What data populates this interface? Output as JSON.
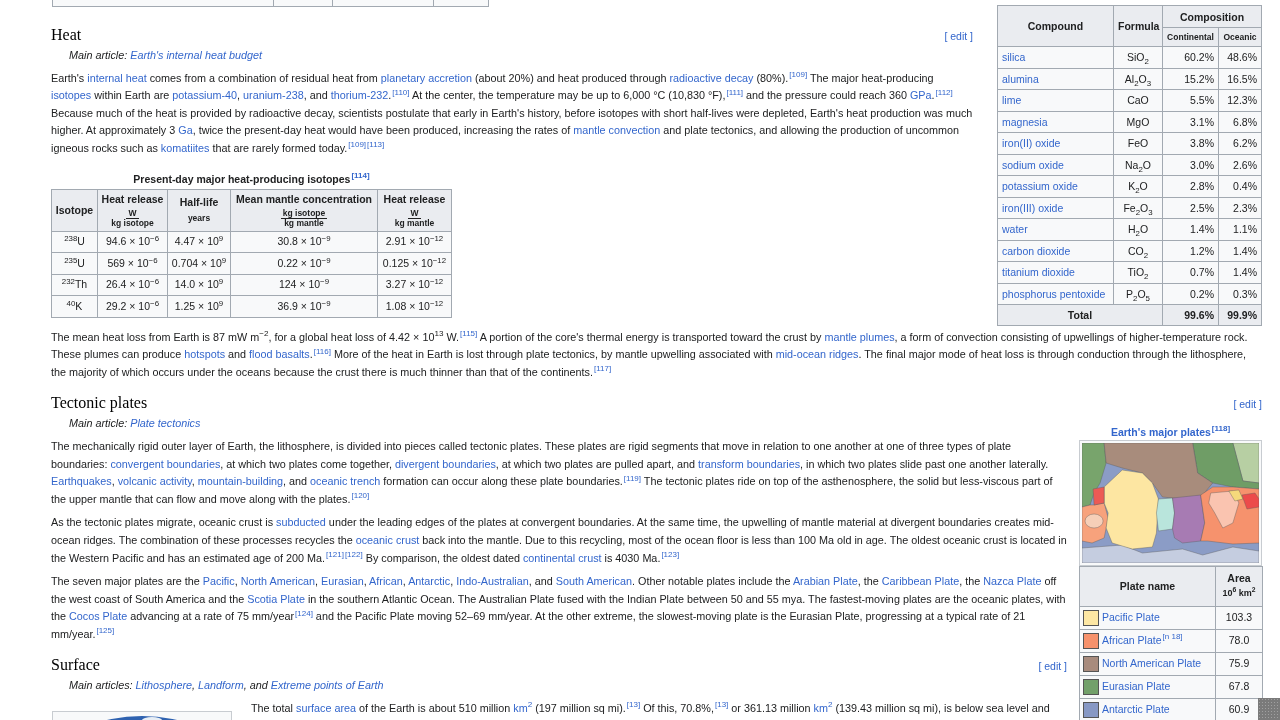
{
  "crust_composition": {
    "columns": [
      {
        "label": "Compound"
      },
      {
        "label": "Formula"
      },
      {
        "label": "Composition",
        "children": [
          {
            "label": "Continental"
          },
          {
            "label": "Oceanic"
          }
        ]
      }
    ],
    "rows": [
      {
        "compound": "silica",
        "formula": "SiO$_{2}$",
        "continental": "60.2%",
        "oceanic": "48.6%"
      },
      {
        "compound": "alumina",
        "formula": "Al$_{2}$O$_{3}$",
        "continental": "15.2%",
        "oceanic": "16.5%"
      },
      {
        "compound": "lime",
        "formula": "CaO",
        "continental": "5.5%",
        "oceanic": "12.3%"
      },
      {
        "compound": "magnesia",
        "formula": "MgO",
        "continental": "3.1%",
        "oceanic": "6.8%"
      },
      {
        "compound": "iron(II) oxide",
        "formula": "FeO",
        "continental": "3.8%",
        "oceanic": "6.2%"
      },
      {
        "compound": "sodium oxide",
        "formula": "Na$_{2}$O",
        "continental": "3.0%",
        "oceanic": "2.6%"
      },
      {
        "compound": "potassium oxide",
        "formula": "K$_{2}$O",
        "continental": "2.8%",
        "oceanic": "0.4%"
      },
      {
        "compound": "iron(III) oxide",
        "formula": "Fe$_{2}$O$_{3}$",
        "continental": "2.5%",
        "oceanic": "2.3%"
      },
      {
        "compound": "water",
        "formula": "H$_{2}$O",
        "continental": "1.4%",
        "oceanic": "1.1%"
      },
      {
        "compound": "carbon dioxide",
        "formula": "CO$_{2}$",
        "continental": "1.2%",
        "oceanic": "1.4%"
      },
      {
        "compound": "titanium dioxide",
        "formula": "TiO$_{2}$",
        "continental": "0.7%",
        "oceanic": "1.4%"
      },
      {
        "compound": "phosphorus pentoxide",
        "formula": "P$_{2}$O$_{5}$",
        "continental": "0.2%",
        "oceanic": "0.3%"
      }
    ],
    "total": {
      "label": "Total",
      "continental": "99.6%",
      "oceanic": "99.9%"
    }
  },
  "sections": [
    {
      "heading": "Heat",
      "edit": "[ edit ]",
      "hatnote": [
        {
          "kind": "text",
          "text": "Main article: "
        },
        {
          "kind": "link",
          "text": "Earth's internal heat budget"
        }
      ],
      "blocks": [
        {
          "kind": "paragraph",
          "runs": [
            {
              "kind": "text",
              "text": "Earth's "
            },
            {
              "kind": "link",
              "text": "internal heat"
            },
            {
              "kind": "text",
              "text": " comes from a combination of residual heat from "
            },
            {
              "kind": "link",
              "text": "planetary accretion"
            },
            {
              "kind": "text",
              "text": " (about 20%) and heat produced through "
            },
            {
              "kind": "link",
              "text": "radioactive decay"
            },
            {
              "kind": "text",
              "text": " (80%)."
            },
            {
              "kind": "ref",
              "text": "[109]"
            },
            {
              "kind": "text",
              "text": " The major heat-producing "
            },
            {
              "kind": "link",
              "text": "isotopes"
            },
            {
              "kind": "text",
              "text": " within Earth are "
            },
            {
              "kind": "link",
              "text": "potassium-40"
            },
            {
              "kind": "text",
              "text": ", "
            },
            {
              "kind": "link",
              "text": "uranium-238"
            },
            {
              "kind": "text",
              "text": ", and "
            },
            {
              "kind": "link",
              "text": "thorium-232"
            },
            {
              "kind": "text",
              "text": "."
            },
            {
              "kind": "ref",
              "text": "[110]"
            },
            {
              "kind": "text",
              "text": " At the center, the temperature may be up to 6,000 °C (10,830 °F),"
            },
            {
              "kind": "ref",
              "text": "[111]"
            },
            {
              "kind": "text",
              "text": " and the pressure could reach 360 "
            },
            {
              "kind": "link",
              "text": "GPa"
            },
            {
              "kind": "text",
              "text": "."
            },
            {
              "kind": "ref",
              "text": "[112]"
            },
            {
              "kind": "text",
              "text": " Because much of the heat is provided by radioactive decay, scientists postulate that early in Earth's history, before isotopes with short half-lives were depleted, Earth's heat production was much higher. At approximately 3 "
            },
            {
              "kind": "link",
              "text": "Ga"
            },
            {
              "kind": "text",
              "text": ", twice the present-day heat would have been produced, increasing the rates of "
            },
            {
              "kind": "link",
              "text": "mantle convection"
            },
            {
              "kind": "text",
              "text": " and plate tectonics, and allowing the production of uncommon igneous rocks such as "
            },
            {
              "kind": "link",
              "text": "komatiites"
            },
            {
              "kind": "text",
              "text": " that are rarely formed today."
            },
            {
              "kind": "ref",
              "text": "[109]"
            },
            {
              "kind": "ref",
              "text": "[113]"
            }
          ]
        },
        {
          "kind": "isotope_table",
          "caption": [
            {
              "kind": "text",
              "text": "Present-day major heat-producing isotopes"
            },
            {
              "kind": "ref",
              "text": "[114]"
            }
          ],
          "columns": [
            {
              "label": "Isotope"
            },
            {
              "label": "Heat release",
              "unit": {
                "kind": "fraction",
                "numerator": "W",
                "denominator": "kg isotope"
              }
            },
            {
              "label": "Half-life",
              "unit": {
                "kind": "plain",
                "text": "years"
              }
            },
            {
              "label": "Mean mantle concentration",
              "unit": {
                "kind": "fraction",
                "numerator": "kg isotope",
                "denominator": "kg mantle"
              }
            },
            {
              "label": "Heat release",
              "unit": {
                "kind": "fraction",
                "numerator": "W",
                "denominator": "kg mantle"
              }
            }
          ],
          "rows": [
            [
              "$^{238}$U",
              "94.6 × 10$^{−6}$",
              "4.47 × 10$^{9}$",
              "30.8 × 10$^{−9}$",
              "2.91 × 10$^{−12}$"
            ],
            [
              "$^{235}$U",
              "569 × 10$^{−6}$",
              "0.704 × 10$^{9}$",
              "0.22 × 10$^{−9}$",
              "0.125 × 10$^{−12}$"
            ],
            [
              "$^{232}$Th",
              "26.4 × 10$^{−6}$",
              "14.0 × 10$^{9}$",
              "124 × 10$^{−9}$",
              "3.27 × 10$^{−12}$"
            ],
            [
              "$^{40}$K",
              "29.2 × 10$^{−6}$",
              "1.25 × 10$^{9}$",
              "36.9 × 10$^{−9}$",
              "1.08 × 10$^{−12}$"
            ]
          ]
        },
        {
          "kind": "paragraph",
          "runs": [
            {
              "kind": "text",
              "text": "The mean heat loss from Earth is 87 mW m$^{−2}$, for a global heat loss of 4.42 × 10$^{13}$ W."
            },
            {
              "kind": "ref",
              "text": "[115]"
            },
            {
              "kind": "text",
              "text": " A portion of the core's thermal energy is transported toward the crust by "
            },
            {
              "kind": "link",
              "text": "mantle plumes"
            },
            {
              "kind": "text",
              "text": ", a form of convection consisting of upwellings of higher-temperature rock. These plumes can produce "
            },
            {
              "kind": "link",
              "text": "hotspots"
            },
            {
              "kind": "text",
              "text": " and "
            },
            {
              "kind": "link",
              "text": "flood basalts"
            },
            {
              "kind": "text",
              "text": "."
            },
            {
              "kind": "ref",
              "text": "[116]"
            },
            {
              "kind": "text",
              "text": " More of the heat in Earth is lost through plate tectonics, by mantle upwelling associated with "
            },
            {
              "kind": "link",
              "text": "mid-ocean ridges"
            },
            {
              "kind": "text",
              "text": ". The final major mode of heat loss is through conduction through the lithosphere, the majority of which occurs under the oceans because the crust there is much thinner than that of the continents."
            },
            {
              "kind": "ref",
              "text": "[117]"
            }
          ]
        }
      ]
    },
    {
      "heading": "Tectonic plates",
      "edit": "[ edit ]",
      "hatnote": [
        {
          "kind": "text",
          "text": "Main article: "
        },
        {
          "kind": "link",
          "text": "Plate tectonics"
        }
      ],
      "blocks": [
        {
          "kind": "paragraph",
          "runs": [
            {
              "kind": "text",
              "text": "The mechanically rigid outer layer of Earth, the lithosphere, is divided into pieces called tectonic plates. These plates are rigid segments that move in relation to one another at one of three types of plate boundaries: "
            },
            {
              "kind": "link",
              "text": "convergent boundaries"
            },
            {
              "kind": "text",
              "text": ", at which two plates come together, "
            },
            {
              "kind": "link",
              "text": "divergent boundaries"
            },
            {
              "kind": "text",
              "text": ", at which two plates are pulled apart, and "
            },
            {
              "kind": "link",
              "text": "transform boundaries"
            },
            {
              "kind": "text",
              "text": ", in which two plates slide past one another laterally. "
            },
            {
              "kind": "link",
              "text": "Earthquakes"
            },
            {
              "kind": "text",
              "text": ", "
            },
            {
              "kind": "link",
              "text": "volcanic activity"
            },
            {
              "kind": "text",
              "text": ", "
            },
            {
              "kind": "link",
              "text": "mountain-building"
            },
            {
              "kind": "text",
              "text": ", and "
            },
            {
              "kind": "link",
              "text": "oceanic trench"
            },
            {
              "kind": "text",
              "text": " formation can occur along these plate boundaries."
            },
            {
              "kind": "ref",
              "text": "[119]"
            },
            {
              "kind": "text",
              "text": " The tectonic plates ride on top of the asthenosphere, the solid but less-viscous part of the upper mantle that can flow and move along with the plates."
            },
            {
              "kind": "ref",
              "text": "[120]"
            }
          ]
        },
        {
          "kind": "paragraph",
          "runs": [
            {
              "kind": "text",
              "text": "As the tectonic plates migrate, oceanic crust is "
            },
            {
              "kind": "link",
              "text": "subducted"
            },
            {
              "kind": "text",
              "text": " under the leading edges of the plates at convergent boundaries. At the same time, the upwelling of mantle material at divergent boundaries creates mid-ocean ridges. The combination of these processes recycles the "
            },
            {
              "kind": "link",
              "text": "oceanic crust"
            },
            {
              "kind": "text",
              "text": " back into the mantle. Due to this recycling, most of the ocean floor is less than 100 Ma old in age. The oldest oceanic crust is located in the Western Pacific and has an estimated age of 200 Ma."
            },
            {
              "kind": "ref",
              "text": "[121]"
            },
            {
              "kind": "ref",
              "text": "[122]"
            },
            {
              "kind": "text",
              "text": " By comparison, the oldest dated "
            },
            {
              "kind": "link",
              "text": "continental crust"
            },
            {
              "kind": "text",
              "text": " is 4030 Ma."
            },
            {
              "kind": "ref",
              "text": "[123]"
            }
          ]
        },
        {
          "kind": "paragraph",
          "runs": [
            {
              "kind": "text",
              "text": "The seven major plates are the "
            },
            {
              "kind": "link",
              "text": "Pacific"
            },
            {
              "kind": "text",
              "text": ", "
            },
            {
              "kind": "link",
              "text": "North American"
            },
            {
              "kind": "text",
              "text": ", "
            },
            {
              "kind": "link",
              "text": "Eurasian"
            },
            {
              "kind": "text",
              "text": ", "
            },
            {
              "kind": "link",
              "text": "African"
            },
            {
              "kind": "text",
              "text": ", "
            },
            {
              "kind": "link",
              "text": "Antarctic"
            },
            {
              "kind": "text",
              "text": ", "
            },
            {
              "kind": "link",
              "text": "Indo-Australian"
            },
            {
              "kind": "text",
              "text": ", and "
            },
            {
              "kind": "link",
              "text": "South American"
            },
            {
              "kind": "text",
              "text": ". Other notable plates include the "
            },
            {
              "kind": "link",
              "text": "Arabian Plate"
            },
            {
              "kind": "text",
              "text": ", the "
            },
            {
              "kind": "link",
              "text": "Caribbean Plate"
            },
            {
              "kind": "text",
              "text": ", the "
            },
            {
              "kind": "link",
              "text": "Nazca Plate"
            },
            {
              "kind": "text",
              "text": " off the west coast of South America and the "
            },
            {
              "kind": "link",
              "text": "Scotia Plate"
            },
            {
              "kind": "text",
              "text": " in the southern Atlantic Ocean. The Australian Plate fused with the Indian Plate between 50 and 55 mya. The fastest-moving plates are the oceanic plates, with the "
            },
            {
              "kind": "link",
              "text": "Cocos Plate"
            },
            {
              "kind": "text",
              "text": " advancing at a rate of 75 mm/year"
            },
            {
              "kind": "ref",
              "text": "[124]"
            },
            {
              "kind": "text",
              "text": " and the Pacific Plate moving 52–69 mm/year. At the other extreme, the slowest-moving plate is the Eurasian Plate, progressing at a typical rate of 21 mm/year."
            },
            {
              "kind": "ref",
              "text": "[125]"
            }
          ]
        }
      ],
      "figure": {
        "kind": "plates_figure",
        "caption": "Earth's major plates",
        "caption_ref": "[118]",
        "columns": [
          {
            "label": "Plate name"
          },
          {
            "label": "Area",
            "unit": "10$^{6}$ km$^{2}$"
          }
        ],
        "rows": [
          {
            "name": "Pacific Plate",
            "color": "#fde7a4",
            "area": "103.3"
          },
          {
            "name": "African Plate",
            "note": "[n 18]",
            "color": "#f7926c",
            "area": "78.0"
          },
          {
            "name": "North American Plate",
            "color": "#a88b7d",
            "area": "75.9"
          },
          {
            "name": "Eurasian Plate",
            "color": "#72a06a",
            "area": "67.8"
          },
          {
            "name": "Antarctic Plate",
            "color": "#8798c4",
            "area": "60.9"
          }
        ]
      }
    },
    {
      "heading": "Surface",
      "edit": "[ edit ]",
      "hatnote": [
        {
          "kind": "text",
          "text": "Main articles: "
        },
        {
          "kind": "link",
          "text": "Lithosphere"
        },
        {
          "kind": "text",
          "text": ", "
        },
        {
          "kind": "link",
          "text": "Landform"
        },
        {
          "kind": "text",
          "text": ", and "
        },
        {
          "kind": "link",
          "text": "Extreme points of Earth"
        }
      ],
      "blocks": [
        {
          "kind": "image"
        },
        {
          "kind": "paragraph",
          "runs": [
            {
              "kind": "text",
              "text": "The total "
            },
            {
              "kind": "link",
              "text": "surface area"
            },
            {
              "kind": "text",
              "text": " of the Earth is about 510 million "
            },
            {
              "kind": "link",
              "text": "km$^{2}$"
            },
            {
              "kind": "text",
              "text": " (197 million sq mi)."
            },
            {
              "kind": "ref",
              "text": "[13]"
            },
            {
              "kind": "text",
              "text": " Of this, 70.8%,"
            },
            {
              "kind": "ref",
              "text": "[13]"
            },
            {
              "kind": "text",
              "text": " or 361.13 million "
            },
            {
              "kind": "link",
              "text": "km$^{2}$"
            },
            {
              "kind": "text",
              "text": " (139.43 million sq mi), is below sea level and"
            }
          ]
        }
      ]
    }
  ]
}
